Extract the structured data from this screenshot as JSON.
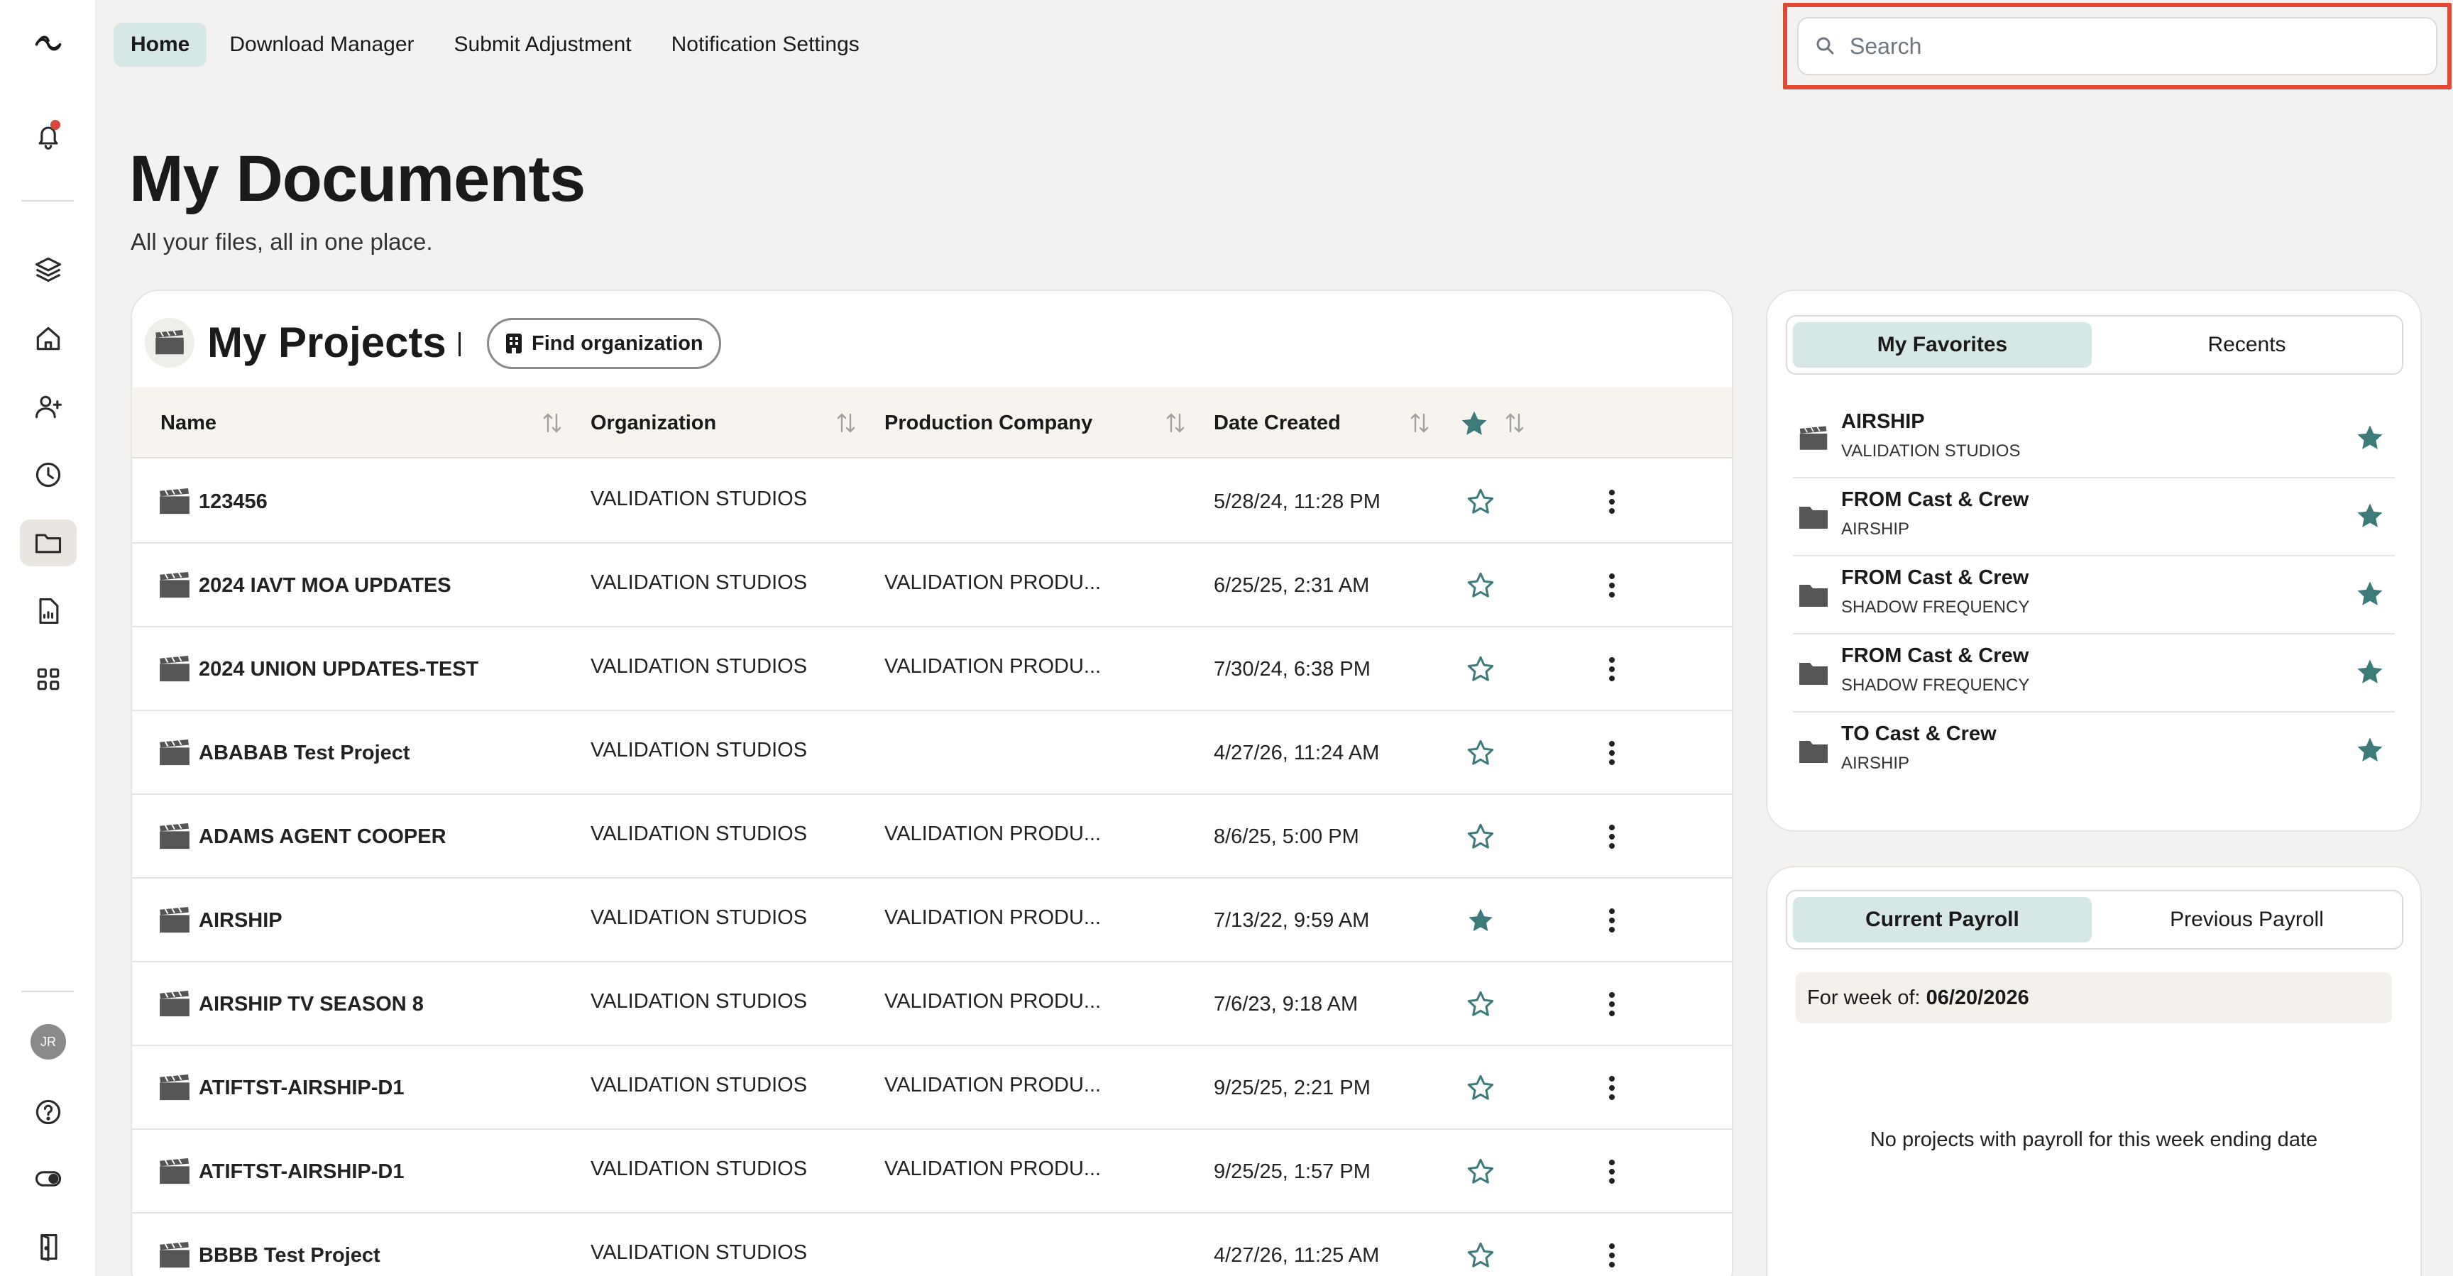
{
  "nav": {
    "items": [
      {
        "label": "Home",
        "active": true
      },
      {
        "label": "Download Manager",
        "active": false
      },
      {
        "label": "Submit Adjustment",
        "active": false
      },
      {
        "label": "Notification Settings",
        "active": false
      }
    ]
  },
  "search": {
    "placeholder": "Search",
    "value": ""
  },
  "sidebar": {
    "avatar_initials": "JR",
    "icons": [
      "logo-icon",
      "bell-icon",
      "layers-icon",
      "home-icon",
      "add-user-icon",
      "clock-icon",
      "folder-icon",
      "document-icon",
      "apps-grid-icon",
      "help-icon",
      "toggle-icon",
      "logout-door-icon"
    ]
  },
  "page": {
    "title": "My Documents",
    "subtitle": "All your files, all in one place."
  },
  "projects": {
    "title": "My Projects",
    "find_org_label": "Find organization",
    "columns": [
      "Name",
      "Organization",
      "Production Company",
      "Date Created"
    ],
    "rows": [
      {
        "name": "123456",
        "org": "VALIDATION STUDIOS",
        "prod": "",
        "date": "5/28/24, 11:28 PM",
        "starred": false
      },
      {
        "name": "2024 IAVT MOA UPDATES",
        "org": "VALIDATION STUDIOS",
        "prod": "VALIDATION PRODU...",
        "date": "6/25/25, 2:31 AM",
        "starred": false
      },
      {
        "name": "2024 UNION UPDATES-TEST",
        "org": "VALIDATION STUDIOS",
        "prod": "VALIDATION PRODU...",
        "date": "7/30/24, 6:38 PM",
        "starred": false
      },
      {
        "name": "ABABAB Test Project",
        "org": "VALIDATION STUDIOS",
        "prod": "",
        "date": "4/27/26, 11:24 AM",
        "starred": false
      },
      {
        "name": "ADAMS AGENT COOPER",
        "org": "VALIDATION STUDIOS",
        "prod": "VALIDATION PRODU...",
        "date": "8/6/25, 5:00 PM",
        "starred": false
      },
      {
        "name": "AIRSHIP",
        "org": "VALIDATION STUDIOS",
        "prod": "VALIDATION PRODU...",
        "date": "7/13/22, 9:59 AM",
        "starred": true
      },
      {
        "name": "AIRSHIP TV SEASON 8",
        "org": "VALIDATION STUDIOS",
        "prod": "VALIDATION PRODU...",
        "date": "7/6/23, 9:18 AM",
        "starred": false
      },
      {
        "name": "ATIFTST-AIRSHIP-D1",
        "org": "VALIDATION STUDIOS",
        "prod": "VALIDATION PRODU...",
        "date": "9/25/25, 2:21 PM",
        "starred": false
      },
      {
        "name": "ATIFTST-AIRSHIP-D1",
        "org": "VALIDATION STUDIOS",
        "prod": "VALIDATION PRODU...",
        "date": "9/25/25, 1:57 PM",
        "starred": false
      },
      {
        "name": "BBBB Test Project",
        "org": "VALIDATION STUDIOS",
        "prod": "",
        "date": "4/27/26, 11:25 AM",
        "starred": false
      }
    ]
  },
  "favorites": {
    "tabs": [
      {
        "label": "My Favorites",
        "active": true
      },
      {
        "label": "Recents",
        "active": false
      }
    ],
    "items": [
      {
        "title": "AIRSHIP",
        "subtitle": "VALIDATION STUDIOS",
        "icon": "clapperboard-icon"
      },
      {
        "title": "FROM Cast & Crew",
        "subtitle": "AIRSHIP",
        "icon": "folder-icon"
      },
      {
        "title": "FROM Cast & Crew",
        "subtitle": "SHADOW FREQUENCY",
        "icon": "folder-icon"
      },
      {
        "title": "FROM Cast & Crew",
        "subtitle": "SHADOW FREQUENCY",
        "icon": "folder-icon"
      },
      {
        "title": "TO Cast & Crew",
        "subtitle": "AIRSHIP",
        "icon": "folder-icon"
      }
    ]
  },
  "payroll": {
    "tabs": [
      {
        "label": "Current Payroll",
        "active": true
      },
      {
        "label": "Previous Payroll",
        "active": false
      }
    ],
    "week_label": "For week of:",
    "week_value": "06/20/2026",
    "empty_message": "No projects with payroll for this week ending date"
  },
  "colors": {
    "accent_teal": "#3d7a7a",
    "active_tab_bg": "#d6e8e6",
    "highlight_red": "#e04a35",
    "notification_dot": "#d9473a",
    "page_bg": "#f3f2f0"
  }
}
